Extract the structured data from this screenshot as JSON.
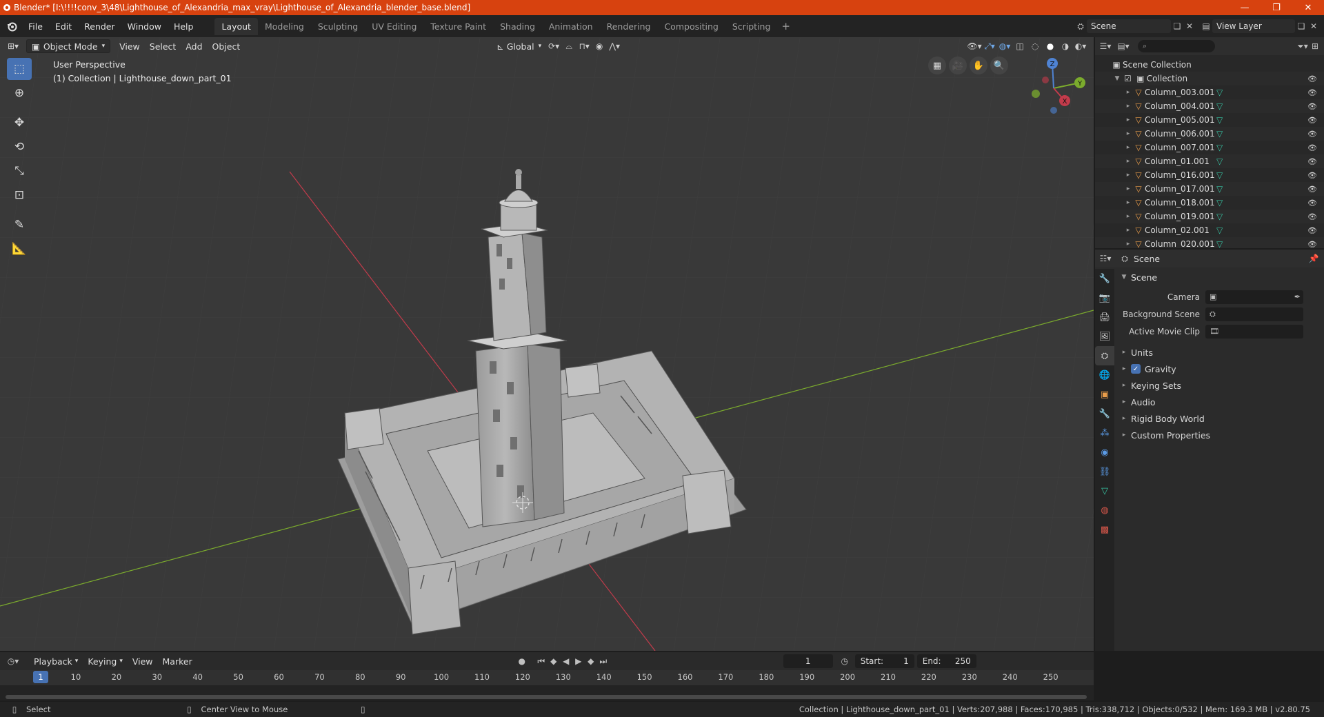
{
  "window": {
    "title": "Blender* [I:\\!!!!conv_3\\48\\Lighthouse_of_Alexandria_max_vray\\Lighthouse_of_Alexandria_blender_base.blend]",
    "minimize": "—",
    "restore": "❐",
    "close": "✕"
  },
  "menu": [
    "File",
    "Edit",
    "Render",
    "Window",
    "Help"
  ],
  "workspaces": [
    "Layout",
    "Modeling",
    "Sculpting",
    "UV Editing",
    "Texture Paint",
    "Shading",
    "Animation",
    "Rendering",
    "Compositing",
    "Scripting"
  ],
  "active_workspace": "Layout",
  "scene_name": "Scene",
  "view_layer": "View Layer",
  "viewport": {
    "mode": "Object Mode",
    "menus": [
      "View",
      "Select",
      "Add",
      "Object"
    ],
    "orientation": "Global",
    "perspective": "User Perspective",
    "collection_info": "(1) Collection | Lighthouse_down_part_01",
    "gizmo_axes": {
      "z": "Z",
      "y": "Y",
      "x": "X"
    }
  },
  "outliner": {
    "root": "Scene Collection",
    "collection": "Collection",
    "items": [
      "Column_003.001",
      "Column_004.001",
      "Column_005.001",
      "Column_006.001",
      "Column_007.001",
      "Column_01.001",
      "Column_016.001",
      "Column_017.001",
      "Column_018.001",
      "Column_019.001",
      "Column_02.001",
      "Column_020.001"
    ]
  },
  "properties": {
    "header": "Scene",
    "panel": "Scene",
    "fields": [
      {
        "label": "Camera"
      },
      {
        "label": "Background Scene"
      },
      {
        "label": "Active Movie Clip"
      }
    ],
    "subpanels": [
      "Units",
      "Gravity",
      "Keying Sets",
      "Audio",
      "Rigid Body World",
      "Custom Properties"
    ]
  },
  "timeline": {
    "menus": [
      "Playback",
      "Keying",
      "View",
      "Marker"
    ],
    "current_frame": "1",
    "start_label": "Start:",
    "start": "1",
    "end_label": "End:",
    "end": "250",
    "ticks": [
      "10",
      "20",
      "30",
      "40",
      "50",
      "60",
      "70",
      "80",
      "90",
      "100",
      "110",
      "120",
      "130",
      "140",
      "150",
      "160",
      "170",
      "180",
      "190",
      "200",
      "210",
      "220",
      "230",
      "240",
      "250"
    ],
    "cursor_frame": "1"
  },
  "status": {
    "left_action": "Select",
    "middle_action": "Center View to Mouse",
    "stats": "Collection | Lighthouse_down_part_01 | Verts:207,988 | Faces:170,985 | Tris:338,712 | Objects:0/532 | Mem: 169.3 MB | v2.80.75"
  },
  "colors": {
    "titlebar": "#d7420f",
    "accent": "#4772b3",
    "viewport_bg": "#393939",
    "x_axis": "#c33b4b",
    "y_axis": "#7bab2d"
  }
}
